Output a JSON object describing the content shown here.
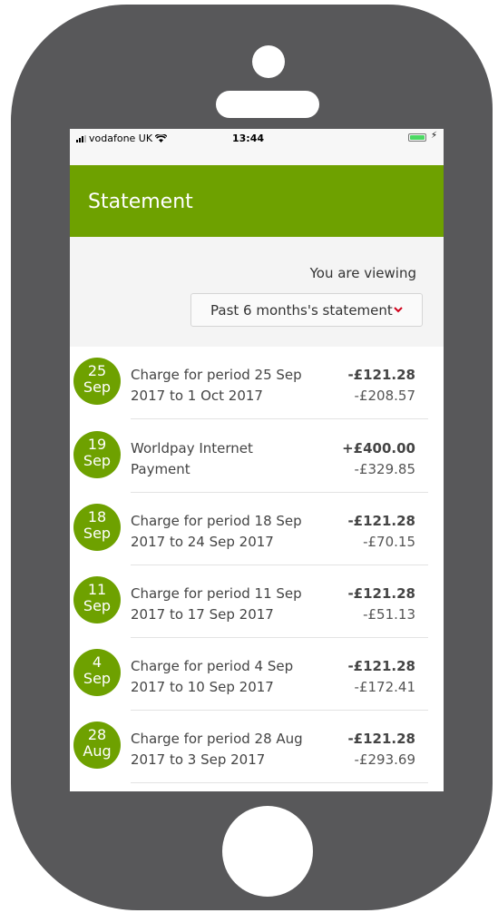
{
  "statusbar": {
    "carrier": "vodafone UK",
    "time": "13:44"
  },
  "header": {
    "title": "Statement"
  },
  "viewing_label": "You are viewing",
  "period_select": {
    "selected": "Past 6 months's statement"
  },
  "transactions": [
    {
      "day": "25",
      "month": "Sep",
      "line1": "Charge for period 25 Sep",
      "line2": "2017 to 1 Oct 2017",
      "amount": "-£121.28",
      "balance": "-£208.57"
    },
    {
      "day": "19",
      "month": "Sep",
      "line1": "Worldpay Internet",
      "line2": "Payment",
      "amount": "+£400.00",
      "balance": "-£329.85"
    },
    {
      "day": "18",
      "month": "Sep",
      "line1": "Charge for period 18 Sep",
      "line2": "2017 to 24 Sep 2017",
      "amount": "-£121.28",
      "balance": "-£70.15"
    },
    {
      "day": "11",
      "month": "Sep",
      "line1": "Charge for period 11 Sep",
      "line2": "2017 to 17 Sep 2017",
      "amount": "-£121.28",
      "balance": "-£51.13"
    },
    {
      "day": "4",
      "month": "Sep",
      "line1": "Charge for period 4 Sep",
      "line2": "2017 to 10 Sep 2017",
      "amount": "-£121.28",
      "balance": "-£172.41"
    },
    {
      "day": "28",
      "month": "Aug",
      "line1": "Charge for period 28 Aug",
      "line2": "2017 to 3 Sep 2017",
      "amount": "-£121.28",
      "balance": "-£293.69"
    }
  ],
  "colors": {
    "brand": "#6ea100",
    "phone_body": "#58585a",
    "chevron": "#d0021b",
    "battery": "#4cd964"
  },
  "icons": {
    "signal": "signal-icon",
    "wifi": "wifi-icon",
    "battery": "battery-icon",
    "dropdown": "chevron-down-icon"
  }
}
